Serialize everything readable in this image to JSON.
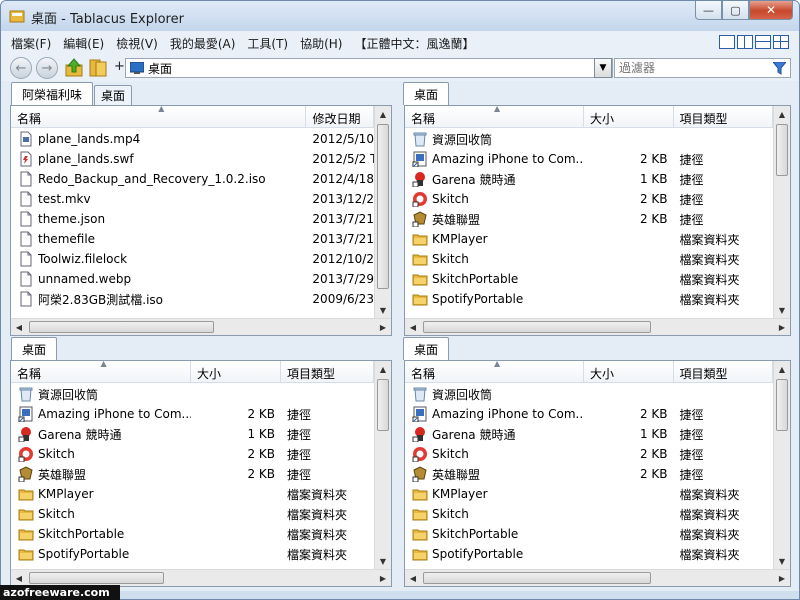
{
  "window": {
    "title": "桌面 - Tablacus Explorer"
  },
  "caption": {
    "minimize": "—",
    "maximize": "▢",
    "close": "✕"
  },
  "menu": [
    "檔案(F)",
    "編輯(E)",
    "檢視(V)",
    "我的最愛(A)",
    "工具(T)",
    "協助(H)",
    "【正體中文：風逸蘭】"
  ],
  "toolbar": {
    "plus": "+",
    "address": "桌面",
    "filter_placeholder": "過濾器"
  },
  "panes": {
    "top_left": {
      "tabs": [
        "阿榮福利味",
        "桌面"
      ],
      "active_tab": 0,
      "columns": [
        "名稱",
        "修改日期"
      ],
      "rows": [
        {
          "icon": "video-file-icon",
          "name": "plane_lands.mp4",
          "date": "2012/5/10"
        },
        {
          "icon": "flash-file-icon",
          "name": "plane_lands.swf",
          "date": "2012/5/2 T"
        },
        {
          "icon": "file-icon",
          "name": "Redo_Backup_and_Recovery_1.0.2.iso",
          "date": "2012/4/18"
        },
        {
          "icon": "file-icon",
          "name": "test.mkv",
          "date": "2013/12/2"
        },
        {
          "icon": "file-icon",
          "name": "theme.json",
          "date": "2013/7/21"
        },
        {
          "icon": "file-icon",
          "name": "themefile",
          "date": "2013/7/21"
        },
        {
          "icon": "file-icon",
          "name": "Toolwiz.filelock",
          "date": "2012/10/2"
        },
        {
          "icon": "file-icon",
          "name": "unnamed.webp",
          "date": "2013/7/29"
        },
        {
          "icon": "file-icon",
          "name": "阿榮2.83GB測試檔.iso",
          "date": "2009/6/23"
        }
      ]
    },
    "top_right": {
      "tabs": [
        "桌面"
      ],
      "active_tab": 0,
      "columns": [
        "名稱",
        "大小",
        "項目類型"
      ],
      "rows": [
        {
          "icon": "recycle-bin-icon",
          "name": "資源回收筒",
          "size": "",
          "type": ""
        },
        {
          "icon": "app-shortcut-icon",
          "name": "Amazing iPhone to Com...",
          "size": "2 KB",
          "type": "捷徑"
        },
        {
          "icon": "garena-icon",
          "name": "Garena 競時通",
          "size": "1 KB",
          "type": "捷徑"
        },
        {
          "icon": "skitch-icon",
          "name": "Skitch",
          "size": "2 KB",
          "type": "捷徑"
        },
        {
          "icon": "lol-icon",
          "name": "英雄聯盟",
          "size": "2 KB",
          "type": "捷徑"
        },
        {
          "icon": "folder-icon",
          "name": "KMPlayer",
          "size": "",
          "type": "檔案資料夾"
        },
        {
          "icon": "folder-icon",
          "name": "Skitch",
          "size": "",
          "type": "檔案資料夾"
        },
        {
          "icon": "folder-icon",
          "name": "SkitchPortable",
          "size": "",
          "type": "檔案資料夾"
        },
        {
          "icon": "folder-icon",
          "name": "SpotifyPortable",
          "size": "",
          "type": "檔案資料夾"
        }
      ]
    },
    "bottom_left": {
      "tabs": [
        "桌面"
      ],
      "active_tab": 0,
      "columns": [
        "名稱",
        "大小",
        "項目類型"
      ],
      "rows": [
        {
          "icon": "recycle-bin-icon",
          "name": "資源回收筒",
          "size": "",
          "type": ""
        },
        {
          "icon": "app-shortcut-icon",
          "name": "Amazing iPhone to Com...",
          "size": "2 KB",
          "type": "捷徑"
        },
        {
          "icon": "garena-icon",
          "name": "Garena 競時通",
          "size": "1 KB",
          "type": "捷徑"
        },
        {
          "icon": "skitch-icon",
          "name": "Skitch",
          "size": "2 KB",
          "type": "捷徑"
        },
        {
          "icon": "lol-icon",
          "name": "英雄聯盟",
          "size": "2 KB",
          "type": "捷徑"
        },
        {
          "icon": "folder-icon",
          "name": "KMPlayer",
          "size": "",
          "type": "檔案資料夾"
        },
        {
          "icon": "folder-icon",
          "name": "Skitch",
          "size": "",
          "type": "檔案資料夾"
        },
        {
          "icon": "folder-icon",
          "name": "SkitchPortable",
          "size": "",
          "type": "檔案資料夾"
        },
        {
          "icon": "folder-icon",
          "name": "SpotifyPortable",
          "size": "",
          "type": "檔案資料夾"
        }
      ]
    },
    "bottom_right": {
      "tabs": [
        "桌面"
      ],
      "active_tab": 0,
      "columns": [
        "名稱",
        "大小",
        "項目類型"
      ],
      "rows": [
        {
          "icon": "recycle-bin-icon",
          "name": "資源回收筒",
          "size": "",
          "type": ""
        },
        {
          "icon": "app-shortcut-icon",
          "name": "Amazing iPhone to Com...",
          "size": "2 KB",
          "type": "捷徑"
        },
        {
          "icon": "garena-icon",
          "name": "Garena 競時通",
          "size": "1 KB",
          "type": "捷徑"
        },
        {
          "icon": "skitch-icon",
          "name": "Skitch",
          "size": "2 KB",
          "type": "捷徑"
        },
        {
          "icon": "lol-icon",
          "name": "英雄聯盟",
          "size": "2 KB",
          "type": "捷徑"
        },
        {
          "icon": "folder-icon",
          "name": "KMPlayer",
          "size": "",
          "type": "檔案資料夾"
        },
        {
          "icon": "folder-icon",
          "name": "Skitch",
          "size": "",
          "type": "檔案資料夾"
        },
        {
          "icon": "folder-icon",
          "name": "SkitchPortable",
          "size": "",
          "type": "檔案資料夾"
        },
        {
          "icon": "folder-icon",
          "name": "SpotifyPortable",
          "size": "",
          "type": "檔案資料夾"
        }
      ]
    }
  },
  "watermark": "azofreeware.com",
  "colors": {
    "folder": "#e8b93c",
    "accent": "#2b5ea8",
    "window_frame": "#cfdff0"
  }
}
